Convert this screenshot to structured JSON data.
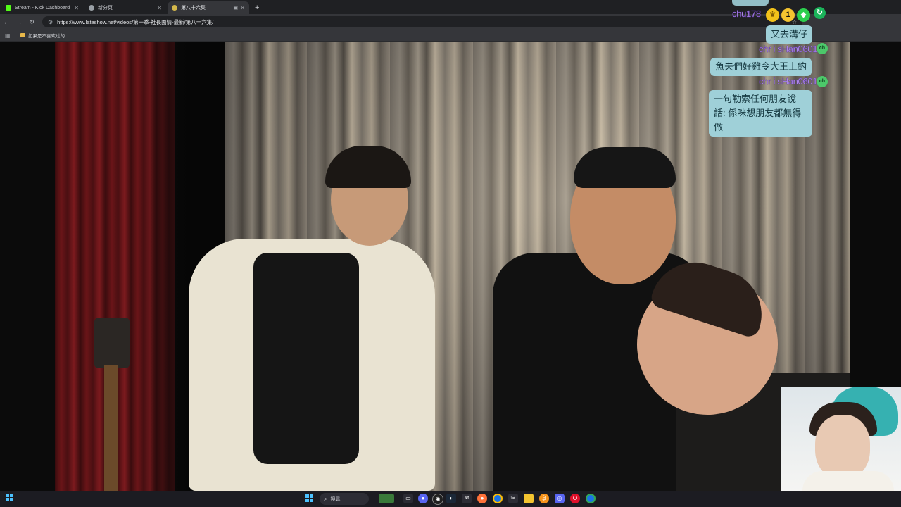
{
  "browser": {
    "tabs": [
      {
        "label": "Stream - Kick Dashboard",
        "favicon_color": "#53fc18",
        "active": false
      },
      {
        "label": "新分頁",
        "favicon_color": "#9aa0a6",
        "active": false
      },
      {
        "label": "第八十六集",
        "favicon_color": "#d4b84a",
        "active": true
      }
    ],
    "new_tab_symbol": "+",
    "close_symbol": "✕",
    "url": "https://www.lateshow.net/videos/第一季-社長團情-最新/第八十六集/",
    "bookmark": {
      "label": "如果是不喜欢过的..."
    }
  },
  "chat": {
    "top_username": "chu178",
    "messages": [
      {
        "username": "",
        "text": "又去溝仔"
      },
      {
        "username": "chr i sHan0601",
        "text": "魚夫們好雞令大王上釣"
      },
      {
        "username": "chr i sHan0601",
        "text": "一句勒索任何朋友說話: 係咪想朋友都無得做"
      }
    ],
    "badge_label": "ch",
    "emote_number": "1"
  },
  "taskbar": {
    "search_placeholder": "搜尋",
    "icons": [
      "start-icon",
      "search-icon",
      "widgets-icon",
      "task-view-icon",
      "chat-icon",
      "discord-icon",
      "obs-icon",
      "steam-icon",
      "mail-icon",
      "firefox-icon",
      "chrome-icon",
      "capcut-icon",
      "files-icon",
      "bitcoin-icon",
      "discord2-icon",
      "opera-icon",
      "chrome2-icon"
    ]
  },
  "colors": {
    "tab_bar": "#1f2023",
    "toolbar": "#35363a",
    "chat_bubble": "#9fd0d8",
    "username": "#c9a6ff",
    "taskbar": "#1c1c22"
  }
}
